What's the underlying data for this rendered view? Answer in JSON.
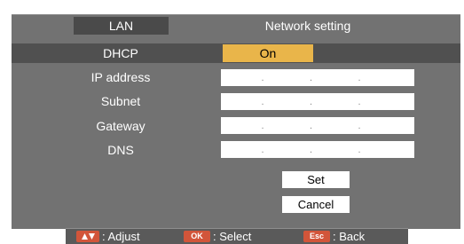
{
  "header": {
    "tab_label": "LAN",
    "title": "Network setting"
  },
  "fields": {
    "dhcp": {
      "label": "DHCP",
      "value": "On"
    },
    "ip_address": {
      "label": "IP address",
      "value": "   .   .   ."
    },
    "subnet": {
      "label": "Subnet",
      "value": "   .   .   ."
    },
    "gateway": {
      "label": "Gateway",
      "value": "   .   .   ."
    },
    "dns": {
      "label": "DNS",
      "value": "   .   .   ."
    }
  },
  "buttons": {
    "set": "Set",
    "cancel": "Cancel"
  },
  "footer": {
    "adjust": {
      "icon": "up-down-arrows-icon",
      "label": ": Adjust"
    },
    "select": {
      "key": "OK",
      "label": ": Select"
    },
    "back": {
      "key": "Esc",
      "label": ": Back"
    }
  },
  "colors": {
    "panel": "#727272",
    "highlight_row": "#505050",
    "dhcp_value": "#e9b54a",
    "key_badge": "#d2553a"
  }
}
